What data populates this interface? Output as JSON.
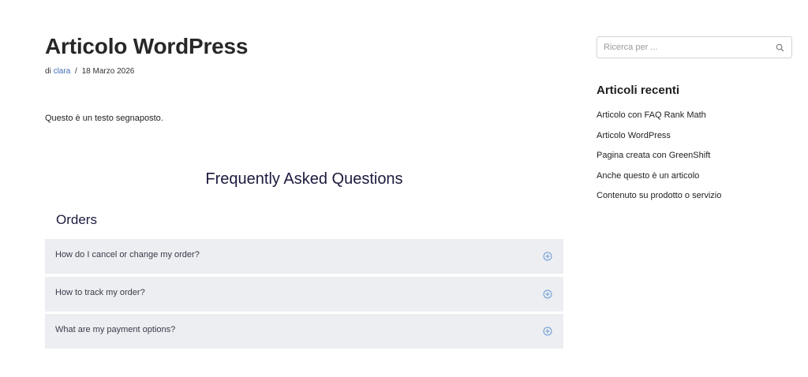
{
  "post": {
    "title": "Articolo WordPress",
    "meta_prefix": "di",
    "author": "clara",
    "separator": "/",
    "date": "18 Marzo 2026",
    "body_text": "Questo è un testo segnaposto."
  },
  "faq": {
    "heading": "Frequently Asked Questions",
    "section_title": "Orders",
    "items": [
      {
        "question": "How do I cancel or change my order?"
      },
      {
        "question": "How to track my order?"
      },
      {
        "question": "What are my payment options?"
      }
    ]
  },
  "sidebar": {
    "search": {
      "placeholder": "Ricerca per ..."
    },
    "recent_posts": {
      "title": "Articoli recenti",
      "items": [
        {
          "label": "Articolo con FAQ Rank Math"
        },
        {
          "label": "Articolo WordPress"
        },
        {
          "label": "Pagina creata con GreenShift"
        },
        {
          "label": "Anche questo è un articolo"
        },
        {
          "label": "Contenuto su prodotto o servizio"
        }
      ]
    }
  },
  "colors": {
    "link": "#3f6fb3",
    "faq_heading": "#1c1a3e",
    "faq_item_bg": "#eceef1",
    "plus_icon": "#6a9bd6"
  },
  "icons": {
    "faq_toggle": "plus-circle-icon",
    "search": "search-icon"
  }
}
